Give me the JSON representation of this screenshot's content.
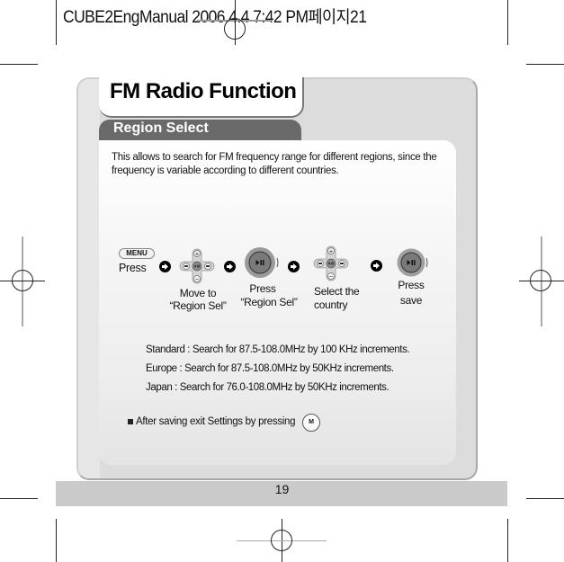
{
  "file_header": {
    "text": "CUBE2EngManual  2006.4.4 7:42 PM페이지21"
  },
  "page": {
    "title": "FM Radio Function",
    "section": "Region Select",
    "intro": "This allows to search for FM frequency range for different regions, since the frequency is variable according to different countries.",
    "page_number": "19"
  },
  "steps": [
    {
      "icon": "menu-button",
      "button_label": "MENU",
      "label": "Press"
    },
    {
      "icon": "dpad-icon",
      "label_line1": "Move to",
      "label_line2": "“Region Sel”"
    },
    {
      "icon": "play-pause-button",
      "label_line1": "Press",
      "label_line2": "“Region Sel”"
    },
    {
      "icon": "dpad-icon",
      "label_line1": "Select the",
      "label_line2": "country"
    },
    {
      "icon": "play-pause-button",
      "label_line1": "Press",
      "label_line2": "save"
    }
  ],
  "regions": [
    {
      "name": "Standard",
      "text": "Standard : Search for 87.5-108.0MHz by 100 KHz increments."
    },
    {
      "name": "Europe",
      "text": "Europe : Search for 87.5-108.0MHz by 50KHz increments."
    },
    {
      "name": "Japan",
      "text": "Japan : Search for 76.0-108.0MHz by 50KHz increments."
    }
  ],
  "note": {
    "text": "After saving exit Settings by pressing",
    "button_label": "M"
  },
  "colors": {
    "panel": "#dcdcdc",
    "section_tab": "#6a6a6a",
    "footer_band": "#cacaca"
  }
}
